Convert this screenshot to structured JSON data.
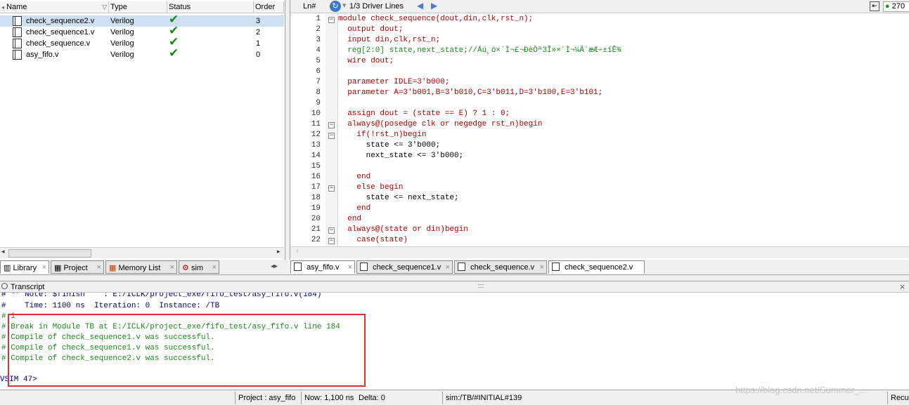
{
  "project_pane": {
    "columns": [
      "Name",
      "Type",
      "Status",
      "Order"
    ],
    "files": [
      {
        "name": "check_sequence2.v",
        "type": "Verilog",
        "status": "check-icon",
        "order": "3"
      },
      {
        "name": "check_sequence1.v",
        "type": "Verilog",
        "status": "check-icon",
        "order": "2"
      },
      {
        "name": "check_sequence.v",
        "type": "Verilog",
        "status": "check-icon",
        "order": "1"
      },
      {
        "name": "asy_fifo.v",
        "type": "Verilog",
        "status": "check-icon",
        "order": "0"
      }
    ],
    "tabs": [
      "Library",
      "Project",
      "Memory List",
      "sim"
    ]
  },
  "editor": {
    "ln_header": "Ln#",
    "driver_lines": "1/3 Driver Lines",
    "right_counter": "270",
    "line_numbers": [
      "1",
      "2",
      "3",
      "4",
      "5",
      "6",
      "7",
      "8",
      "9",
      "10",
      "11",
      "12",
      "13",
      "14",
      "15",
      "16",
      "17",
      "18",
      "19",
      "20",
      "21",
      "22"
    ],
    "code": [
      "module check_sequence(dout,din,clk,rst_n);",
      "  output dout;",
      "  input din,clk,rst_n;",
      "  reg[2:0] state,next_state;//Áú¸ö×´Ì¬£¬ÐèÒª3Î»×´Ì¬¼Ä´æÆ÷±íÊ¾",
      "  wire dout;",
      "",
      "  parameter IDLE=3'b000;",
      "  parameter A=3'b001,B=3'b010,C=3'b011,D=3'b100,E=3'b101;",
      "",
      "  assign dout = (state == E) ? 1 : 0;",
      "  always@(posedge clk or negedge rst_n)begin",
      "    if(!rst_n)begin",
      "      state <= 3'b000;",
      "      next_state <= 3'b000;",
      "",
      "    end",
      "    else begin",
      "      state <= next_state;",
      "    end",
      "  end",
      "  always@(state or din)begin",
      "    case(state)"
    ],
    "tabs": [
      "asy_fifo.v",
      "check_sequence1.v",
      "check_sequence.v",
      "check_sequence2.v"
    ]
  },
  "transcript": {
    "title": "Transcript",
    "lines": [
      "# ** Note: $finish    : E:/ICLK/project_exe/fifo_test/asy_fifo.v(184)",
      "#    Time: 1100 ns  Iteration: 0  Instance: /TB",
      "# 1",
      "# Break in Module TB at E:/ICLK/project_exe/fifo_test/asy_fifo.v line 184",
      "# Compile of check_sequence1.v was successful.",
      "# Compile of check_sequence1.v was successful.",
      "# Compile of check_sequence2.v was successful.",
      "",
      "VSIM 47>"
    ]
  },
  "status_bar": {
    "project": "Project : asy_fifo",
    "now": "Now: 1,100 ns",
    "delta": "Delta: 0",
    "sim_path": "sim:/TB/#INITIAL#139",
    "right": "Recur"
  },
  "watermark": "https://blog.csdn.net/Summer_..."
}
